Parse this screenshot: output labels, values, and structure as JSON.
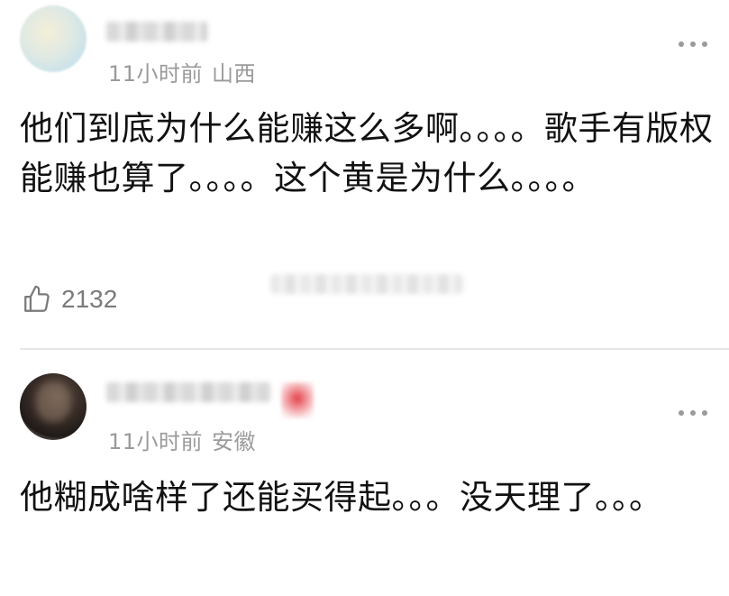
{
  "comments": [
    {
      "time": "11小时前",
      "location": "山西",
      "text": "他们到底为什么能赚这么多啊。。。。歌手有版权能赚也算了。。。。这个黄是为什么。。。。",
      "likes": "2132"
    },
    {
      "time": "11小时前",
      "location": "安徽",
      "text": "他糊成啥样了还能买得起。。。没天理了。。。"
    }
  ],
  "icons": {
    "more": "more-dots-icon",
    "like": "thumbs-up-icon"
  },
  "colors": {
    "meta_text": "#9a9a9a",
    "body_text": "#111111",
    "divider": "#e6e6e6",
    "badge_red": "#e3414a"
  }
}
